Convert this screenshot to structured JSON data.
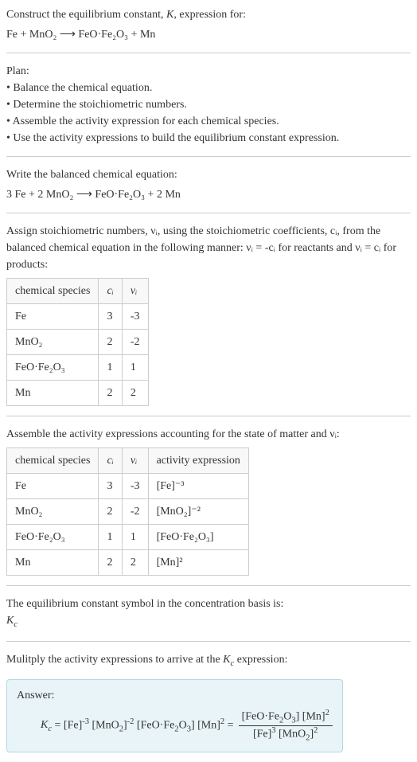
{
  "intro": {
    "line1_prefix": "Construct the equilibrium constant, ",
    "line1_k": "K",
    "line1_suffix": ", expression for:",
    "equation": "Fe + MnO₂ ⟶ FeO·Fe₂O₃ + Mn"
  },
  "plan": {
    "title": "Plan:",
    "items": [
      "• Balance the chemical equation.",
      "• Determine the stoichiometric numbers.",
      "• Assemble the activity expression for each chemical species.",
      "• Use the activity expressions to build the equilibrium constant expression."
    ]
  },
  "balanced": {
    "title": "Write the balanced chemical equation:",
    "equation": "3 Fe + 2 MnO₂ ⟶ FeO·Fe₂O₃ + 2 Mn"
  },
  "assign": {
    "line": "Assign stoichiometric numbers, νᵢ, using the stoichiometric coefficients, cᵢ, from the balanced chemical equation in the following manner: νᵢ = -cᵢ for reactants and νᵢ = cᵢ for products:",
    "headers": {
      "col1": "chemical species",
      "col2": "cᵢ",
      "col3": "νᵢ"
    },
    "rows": [
      {
        "species": "Fe",
        "c": "3",
        "v": "-3"
      },
      {
        "species": "MnO₂",
        "c": "2",
        "v": "-2"
      },
      {
        "species": "FeO·Fe₂O₃",
        "c": "1",
        "v": "1"
      },
      {
        "species": "Mn",
        "c": "2",
        "v": "2"
      }
    ]
  },
  "assemble": {
    "line": "Assemble the activity expressions accounting for the state of matter and νᵢ:",
    "headers": {
      "col1": "chemical species",
      "col2": "cᵢ",
      "col3": "νᵢ",
      "col4": "activity expression"
    },
    "rows": [
      {
        "species": "Fe",
        "c": "3",
        "v": "-3",
        "activity": "[Fe]⁻³"
      },
      {
        "species": "MnO₂",
        "c": "2",
        "v": "-2",
        "activity": "[MnO₂]⁻²"
      },
      {
        "species": "FeO·Fe₂O₃",
        "c": "1",
        "v": "1",
        "activity": "[FeO·Fe₂O₃]"
      },
      {
        "species": "Mn",
        "c": "2",
        "v": "2",
        "activity": "[Mn]²"
      }
    ]
  },
  "symbol": {
    "line": "The equilibrium constant symbol in the concentration basis is:",
    "value": "K_c"
  },
  "multiply": {
    "line": "Mulitply the activity expressions to arrive at the K_c expression:"
  },
  "answer": {
    "label": "Answer:",
    "lhs": "K_c = [Fe]⁻³ [MnO₂]⁻² [FeO·Fe₂O₃] [Mn]² = ",
    "frac_num": "[FeO·Fe₂O₃] [Mn]²",
    "frac_den": "[Fe]³ [MnO₂]²"
  }
}
